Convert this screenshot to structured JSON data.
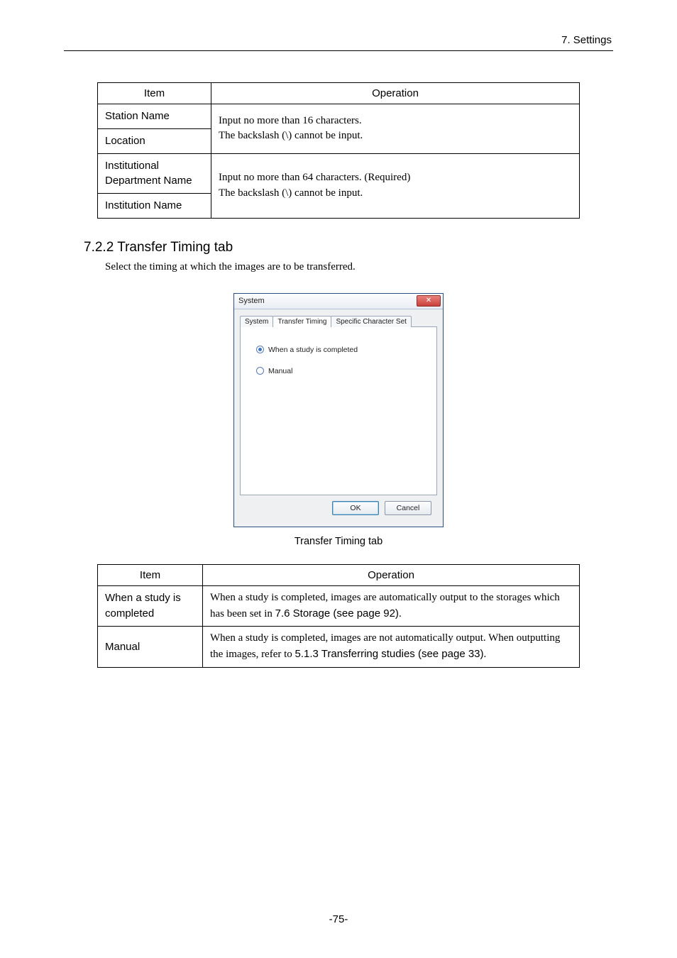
{
  "header": {
    "section_label": "7. Settings"
  },
  "table1": {
    "head": {
      "item": "Item",
      "operation": "Operation"
    },
    "rows": {
      "station_name": "Station Name",
      "location": "Location",
      "institutional_department_name": "Institutional Department Name",
      "institution_name": "Institution Name"
    },
    "op_group1_line1": "Input no more than 16 characters.",
    "op_group1_line2": "The backslash (\\) cannot be input.",
    "op_group2_line1": "Input no more than 64 characters. (Required)",
    "op_group2_line2": "The backslash (\\) cannot be input."
  },
  "section": {
    "heading": "7.2.2 Transfer Timing tab",
    "intro": "Select the timing at which the images are to be transferred."
  },
  "dialog": {
    "title": "System",
    "close_glyph": "✕",
    "tabs": {
      "system": "System",
      "transfer": "Transfer Timing",
      "charset": "Specific Character Set"
    },
    "radio_completed": "When a study is completed",
    "radio_manual": "Manual",
    "ok": "OK",
    "cancel": "Cancel"
  },
  "caption": "Transfer Timing tab",
  "table2": {
    "head": {
      "item": "Item",
      "operation": "Operation"
    },
    "row1_item": "When a study is completed",
    "row1_op_a": "When a study is completed, images are automatically output to the storages which has been set in ",
    "row1_op_b": "7.6 Storage (see page 92)",
    "row1_op_c": ".",
    "row2_item": "Manual",
    "row2_op_a": "When a study is completed, images are not automatically output. When outputting the images, refer to ",
    "row2_op_b": "5.1.3 Transferring studies (see page 33)",
    "row2_op_c": "."
  },
  "footer": {
    "page": "-75-"
  }
}
